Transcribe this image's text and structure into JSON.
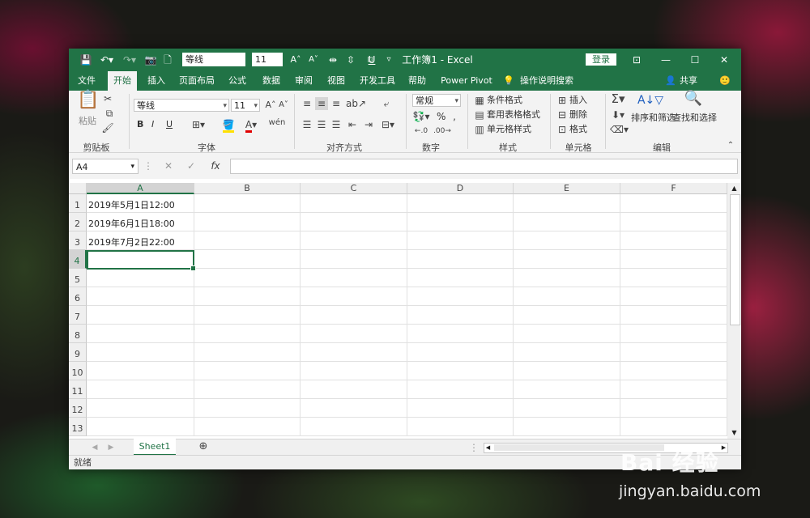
{
  "window": {
    "title": "工作簿1 - Excel",
    "accent": "#217346"
  },
  "quick_access": {
    "font_name": "等线",
    "font_size": "11"
  },
  "title_buttons": {
    "login": "登录"
  },
  "tabs": [
    "文件",
    "开始",
    "插入",
    "页面布局",
    "公式",
    "数据",
    "审阅",
    "视图",
    "开发工具",
    "帮助",
    "Power Pivot",
    "操作说明搜索"
  ],
  "share_label": "共享",
  "ribbon": {
    "clipboard": {
      "paste": "粘贴",
      "label": "剪贴板"
    },
    "font": {
      "name": "等线",
      "size": "11",
      "label": "字体",
      "bold": "B",
      "italic": "I",
      "underline": "U"
    },
    "alignment": {
      "label": "对齐方式"
    },
    "number": {
      "format": "常规",
      "label": "数字",
      "percent": "%"
    },
    "styles": {
      "conditional": "条件格式",
      "table": "套用表格格式",
      "cell": "单元格样式",
      "label": "样式"
    },
    "cells": {
      "insert": "插入",
      "delete": "删除",
      "format": "格式",
      "label": "单元格"
    },
    "editing": {
      "sort": "排序和筛选",
      "find": "查找和选择",
      "label": "编辑"
    }
  },
  "formula_bar": {
    "name_box": "A4",
    "fx": "fx",
    "content": ""
  },
  "columns": [
    "A",
    "B",
    "C",
    "D",
    "E",
    "F"
  ],
  "rows": [
    "1",
    "2",
    "3",
    "4",
    "5",
    "6",
    "7",
    "8",
    "9",
    "10",
    "11",
    "12",
    "13"
  ],
  "cells": {
    "A1": "2019年5月1日12:00",
    "A2": "2019年6月1日18:00",
    "A3": "2019年7月2日22:00"
  },
  "selected_cell": "A4",
  "sheet_tabs": [
    "Sheet1"
  ],
  "status": "就绪",
  "watermark": {
    "logo": "Bai 经验",
    "url": "jingyan.baidu.com"
  }
}
